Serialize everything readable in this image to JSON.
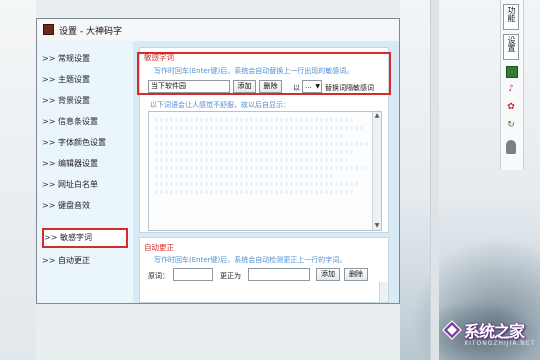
{
  "window": {
    "title": "设置 - 大神码字"
  },
  "nav": {
    "items": [
      {
        "label": "常规设置"
      },
      {
        "label": "主题设置"
      },
      {
        "label": "背景设置"
      },
      {
        "label": "信息条设置"
      },
      {
        "label": "字体颜色设置"
      },
      {
        "label": "编辑器设置"
      },
      {
        "label": "网址白名单"
      },
      {
        "label": "键盘音效"
      },
      {
        "label": "敏感字词"
      },
      {
        "label": "自动更正"
      }
    ],
    "arrow": ">>",
    "active_index": 8
  },
  "sensitive": {
    "title": "敏感字词",
    "hint": "写作时回车(Enter键)后，系统会自动替换上一行出现的敏感词。",
    "word_value": "当下软件园",
    "add_label": "添加",
    "delete_label": "删除",
    "with_label": "以",
    "replace_value": "...",
    "replace_label": "替换词隔敏感词",
    "list_hint": "以下词语会让人感觉不舒服，故以后自显示："
  },
  "autocorrect": {
    "title": "自动更正",
    "hint": "写作时回车(Enter键)后，系统会自动检测更正上一行的字词。",
    "original_label": "原词：",
    "correct_label": "更正为",
    "add_label": "添加",
    "delete_label": "删除"
  },
  "side_toolbar": {
    "buttons": [
      "功能",
      "设置"
    ],
    "icons": [
      "save-icon",
      "music-icon",
      "star-icon",
      "refresh-icon",
      "bulb-icon"
    ]
  },
  "watermark": {
    "text": "系统之家",
    "sub": "XITONGZHIJIA.NET"
  },
  "colors": {
    "accent_red": "#d52b2b",
    "hint_blue": "#4d8fd2",
    "nav_bg": "#eaf5fc"
  }
}
